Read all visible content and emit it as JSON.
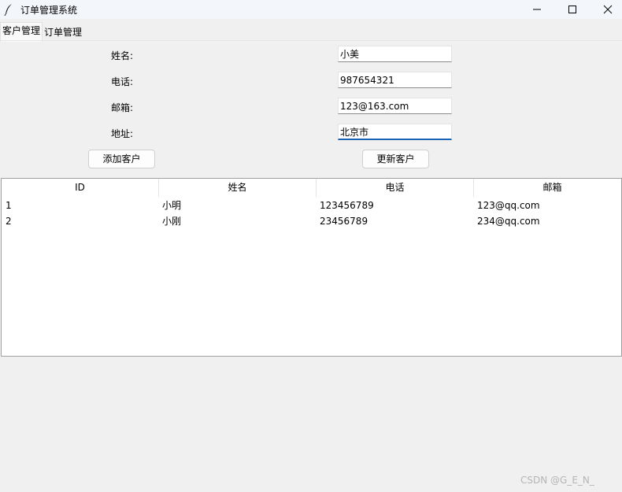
{
  "window": {
    "title": "订单管理系统",
    "icon": "feather-icon"
  },
  "tabs": [
    {
      "label": "客户管理",
      "active": true
    },
    {
      "label": "订单管理",
      "active": false
    }
  ],
  "form": {
    "name_label": "姓名:",
    "phone_label": "电话:",
    "email_label": "邮箱:",
    "address_label": "地址:",
    "name_value": "小美",
    "phone_value": "987654321",
    "email_value": "123@163.com",
    "address_value": "北京市",
    "add_button": "添加客户",
    "update_button": "更新客户"
  },
  "table": {
    "headers": [
      "ID",
      "姓名",
      "电话",
      "邮箱"
    ],
    "rows": [
      [
        "1",
        "小明",
        "123456789",
        "123@qq.com"
      ],
      [
        "2",
        "小刚",
        "23456789",
        "234@qq.com"
      ]
    ]
  },
  "watermark": "CSDN @G_E_N_"
}
